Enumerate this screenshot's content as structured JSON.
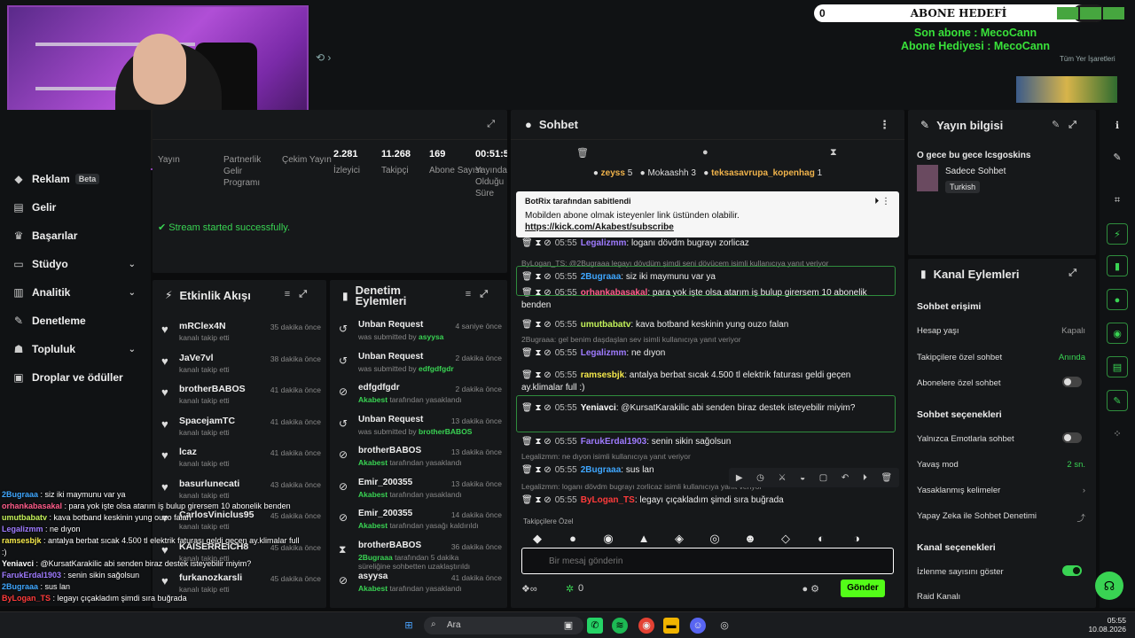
{
  "overlay": {
    "goal_zero": "0",
    "goal_label": "ABONE HEDEFİ",
    "goal_max": "25",
    "last_sub": "Son abone : MecoCann",
    "gift_sub": "Abone Hediyesi : MecoCann",
    "all_marks": "Tüm Yer İşaretleri"
  },
  "sidebar": {
    "items": [
      {
        "label": "Reklam",
        "badge": "Beta",
        "icon": "megaphone-icon"
      },
      {
        "label": "Gelir",
        "icon": "bar-chart-icon"
      },
      {
        "label": "Başarılar",
        "icon": "trophy-icon"
      },
      {
        "label": "Stüdyo",
        "icon": "studio-icon"
      },
      {
        "label": "Analitik",
        "icon": "analytics-icon"
      },
      {
        "label": "Denetleme",
        "icon": "wrench-icon"
      },
      {
        "label": "Topluluk",
        "icon": "community-icon"
      },
      {
        "label": "Droplar ve ödüller",
        "icon": "gift-icon"
      }
    ]
  },
  "stats": {
    "items": [
      {
        "value": "",
        "label": "Yayın"
      },
      {
        "value": "",
        "label": "Partnerlik Gelir Programı"
      },
      {
        "value": "",
        "label": "Çekim Yayın"
      },
      {
        "value": "2.281",
        "label": "İzleyici"
      },
      {
        "value": "11.268",
        "label": "Takipçi"
      },
      {
        "value": "169",
        "label": "Abone Sayısı"
      },
      {
        "value": "00:51:5",
        "label": "Yayında Olduğu Süre"
      }
    ],
    "banner": "Stream started successfully."
  },
  "events": {
    "title": "Etkinlik Akışı",
    "rows": [
      {
        "name": "mRClex4N",
        "sub": "kanalı takip etti",
        "time": "35 dakika önce"
      },
      {
        "name": "JaVe7vl",
        "sub": "kanalı takip etti",
        "time": "38 dakika önce"
      },
      {
        "name": "brotherBABOS",
        "sub": "kanalı takip etti",
        "time": "41 dakika önce"
      },
      {
        "name": "SpacejamTC",
        "sub": "kanalı takip etti",
        "time": "41 dakika önce"
      },
      {
        "name": "lcaz",
        "sub": "kanalı takip etti",
        "time": "41 dakika önce"
      },
      {
        "name": "basurlunecati",
        "sub": "kanalı takip etti",
        "time": "43 dakika önce"
      },
      {
        "name": "CarlosViniclus95",
        "sub": "kanalı takip etti",
        "time": "45 dakika önce"
      },
      {
        "name": "KAISERREICH8",
        "sub": "kanalı takip etti",
        "time": "45 dakika önce"
      },
      {
        "name": "furkanozkarsli",
        "sub": "kanalı takip etti",
        "time": "45 dakika önce"
      }
    ]
  },
  "moderation": {
    "title": "Denetim Eylemleri",
    "rows": [
      {
        "icon": "undo-icon",
        "name": "Unban Request",
        "actor": "",
        "sub": "was submitted by ",
        "who": "asyysa",
        "time": "4 saniye önce"
      },
      {
        "icon": "undo-icon",
        "name": "Unban Request",
        "actor": "",
        "sub": "was submitted by ",
        "who": "edfgdfgdr",
        "time": "2 dakika önce"
      },
      {
        "icon": "ban-icon",
        "name": "edfgdfgdr",
        "actor": "Akabest",
        "sub": " tarafından yasaklandı",
        "who": "",
        "time": "2 dakika önce"
      },
      {
        "icon": "undo-icon",
        "name": "Unban Request",
        "actor": "",
        "sub": "was submitted by ",
        "who": "brotherBABOS",
        "time": "13 dakika önce"
      },
      {
        "icon": "ban-icon",
        "name": "brotherBABOS",
        "actor": "Akabest",
        "sub": " tarafından yasaklandı",
        "who": "",
        "time": "13 dakika önce"
      },
      {
        "icon": "ban-icon",
        "name": "Emir_200355",
        "actor": "Akabest",
        "sub": " tarafından yasaklandı",
        "who": "",
        "time": "13 dakika önce"
      },
      {
        "icon": "ban-icon",
        "name": "Emir_200355",
        "actor": "Akabest",
        "sub": " tarafından yasağı kaldırıldı",
        "who": "",
        "time": "14 dakika önce"
      },
      {
        "icon": "hourglass-icon",
        "name": "brotherBABOS",
        "actor": "2Bugraaa",
        "sub": " tarafından 5 dakika süreliğine sohbetten uzaklaştırıldı",
        "who": "",
        "time": "36 dakika önce"
      },
      {
        "icon": "ban-icon",
        "name": "asyysa",
        "actor": "Akabest",
        "sub": " tarafından yasaklandı",
        "who": "",
        "time": "41 dakika önce"
      }
    ]
  },
  "chat": {
    "title": "Sohbet",
    "gifters": [
      {
        "name": "zeyss",
        "count": "5"
      },
      {
        "name": "Mokaashh",
        "count": "3"
      },
      {
        "name": "teksasavrupa_kopenhag",
        "count": "1"
      }
    ],
    "pinned": {
      "who": "BotRix tarafından sabitlendi",
      "text": "Mobilden abone olmak isteyenler link üstünden olabilir.",
      "link": "https://kick.com/Akabest/subscribe"
    },
    "messages": [
      {
        "ts": "05:55",
        "user": "Legalizmm",
        "color": "#9f7bff",
        "text": ": loganı dövdm bugrayı zorlicaz",
        "reply": ""
      },
      {
        "ts": "05:55",
        "user": "2Bugraaa",
        "color": "#3fa7ff",
        "text": ": siz iki maymunu var ya",
        "reply": "ByLogan_TS: @2Bugraaa legayı dövdüm şimdi seni dövücem isimli kullanıcıya yanıt veriyor"
      },
      {
        "ts": "05:55",
        "user": "orhankabasakal",
        "color": "#ff5c8a",
        "text": ": para yok işte olsa atarım iş bulup girersem 10 abonelik benden",
        "reply": ""
      },
      {
        "ts": "05:55",
        "user": "umutbabatv",
        "color": "#c4f25a",
        "text": ": kava botband keskinin yung ouzo falan",
        "reply": ""
      },
      {
        "ts": "05:55",
        "user": "Legalizmm",
        "color": "#9f7bff",
        "text": ": ne dıyon",
        "reply": "2Bugraaa: gel benim daşdaşlan sev isimli kullanıcıya yanıt veriyor"
      },
      {
        "ts": "05:55",
        "user": "ramsesbjk",
        "color": "#f5e94b",
        "text": ": antalya berbat sıcak 4.500 tl elektrik faturası geldi geçen ay.klimalar full :)",
        "reply": ""
      },
      {
        "ts": "05:55",
        "user": "Yeniavci",
        "color": "#ffffff",
        "text": ": @KursatKarakilic abi senden biraz destek isteyebilir miyim?",
        "reply": ""
      },
      {
        "ts": "05:55",
        "user": "FarukErdal1903",
        "color": "#9f7bff",
        "text": ": senin sikin sağolsun",
        "reply": ""
      },
      {
        "ts": "05:55",
        "user": "2Bugraaa",
        "color": "#3fa7ff",
        "text": ": sus lan",
        "reply": "Legalizmm: ne dıyon isimli kullanıcıya yanıt veriyor"
      },
      {
        "ts": "05:55",
        "user": "ByLogan_TS",
        "color": "#ff3b3b",
        "text": ": legayı çıçakladım şimdi sıra buğrada",
        "reply": "Legalizmm: loganı dövdm bugrayı zorlicaz isimli kullanıcıya yanıt veriyor"
      }
    ],
    "followers_only_emotes": "Takipçilere Özel",
    "placeholder": "Bir mesaj gönderin",
    "points": "0",
    "send_label": "Gönder"
  },
  "info": {
    "title": "Yayın bilgisi",
    "stream_title": "O gece bu gece lcsgoskins",
    "category": "Sadece Sohbet",
    "tag": "Turkish"
  },
  "actions": {
    "title": "Kanal Eylemleri",
    "chat_access": "Sohbet erişimi",
    "account_age": "Hesap yaşı",
    "account_age_val": "Kapalı",
    "followers_only": "Takipçilere özel sohbet",
    "followers_only_val": "Anında",
    "subs_only": "Abonelere özel sohbet",
    "chat_options": "Sohbet seçenekleri",
    "emotes_only": "Yalnızca Emotlarla sohbet",
    "slow_mode": "Yavaş mod",
    "slow_mode_val": "2 sn.",
    "banned_words": "Yasaklanmış kelimeler",
    "ai_moderation": "Yapay Zeka ile Sohbet Denetimi",
    "channel_options": "Kanal seçenekleri",
    "show_viewers": "İzlenme sayısını göster",
    "raid": "Raid Kanalı"
  },
  "overlay_chat": [
    {
      "user": "2Bugraaa",
      "color": "#3fa7ff",
      "text": " : siz iki maymunu var ya"
    },
    {
      "user": "orhankabasakal",
      "color": "#ff5c8a",
      "text": " : para yok işte olsa atarım iş bulup girersem 10 abonelik benden"
    },
    {
      "user": "umutbabatv",
      "color": "#c4f25a",
      "text": " : kava botband keskinin yung ouzo falan"
    },
    {
      "user": "Legalizmm",
      "color": "#9f7bff",
      "text": " : ne dıyon"
    },
    {
      "user": "ramsesbjk",
      "color": "#f5e94b",
      "text": " : antalya berbat sıcak 4.500 tl elektrik faturası geldi geçen ay.klimalar full :)"
    },
    {
      "user": "Yeniavci",
      "color": "#ffffff",
      "text": " : @KursatKarakilic abi senden biraz destek isteyebilir miyim?"
    },
    {
      "user": "FarukErdal1903",
      "color": "#9f7bff",
      "text": " : senin sikin sağolsun"
    },
    {
      "user": "2Bugraaa",
      "color": "#3fa7ff",
      "text": " : sus lan"
    },
    {
      "user": "ByLogan_TS",
      "color": "#ff3b3b",
      "text": " : legayı çıçakladım şimdi sıra buğrada"
    }
  ],
  "taskbar": {
    "search": "Ara",
    "time": "05:55",
    "date": "10.08.2026"
  },
  "colors": {
    "accent": "#53fc18",
    "panel": "#16181a",
    "bg": "#0b0c0d"
  }
}
